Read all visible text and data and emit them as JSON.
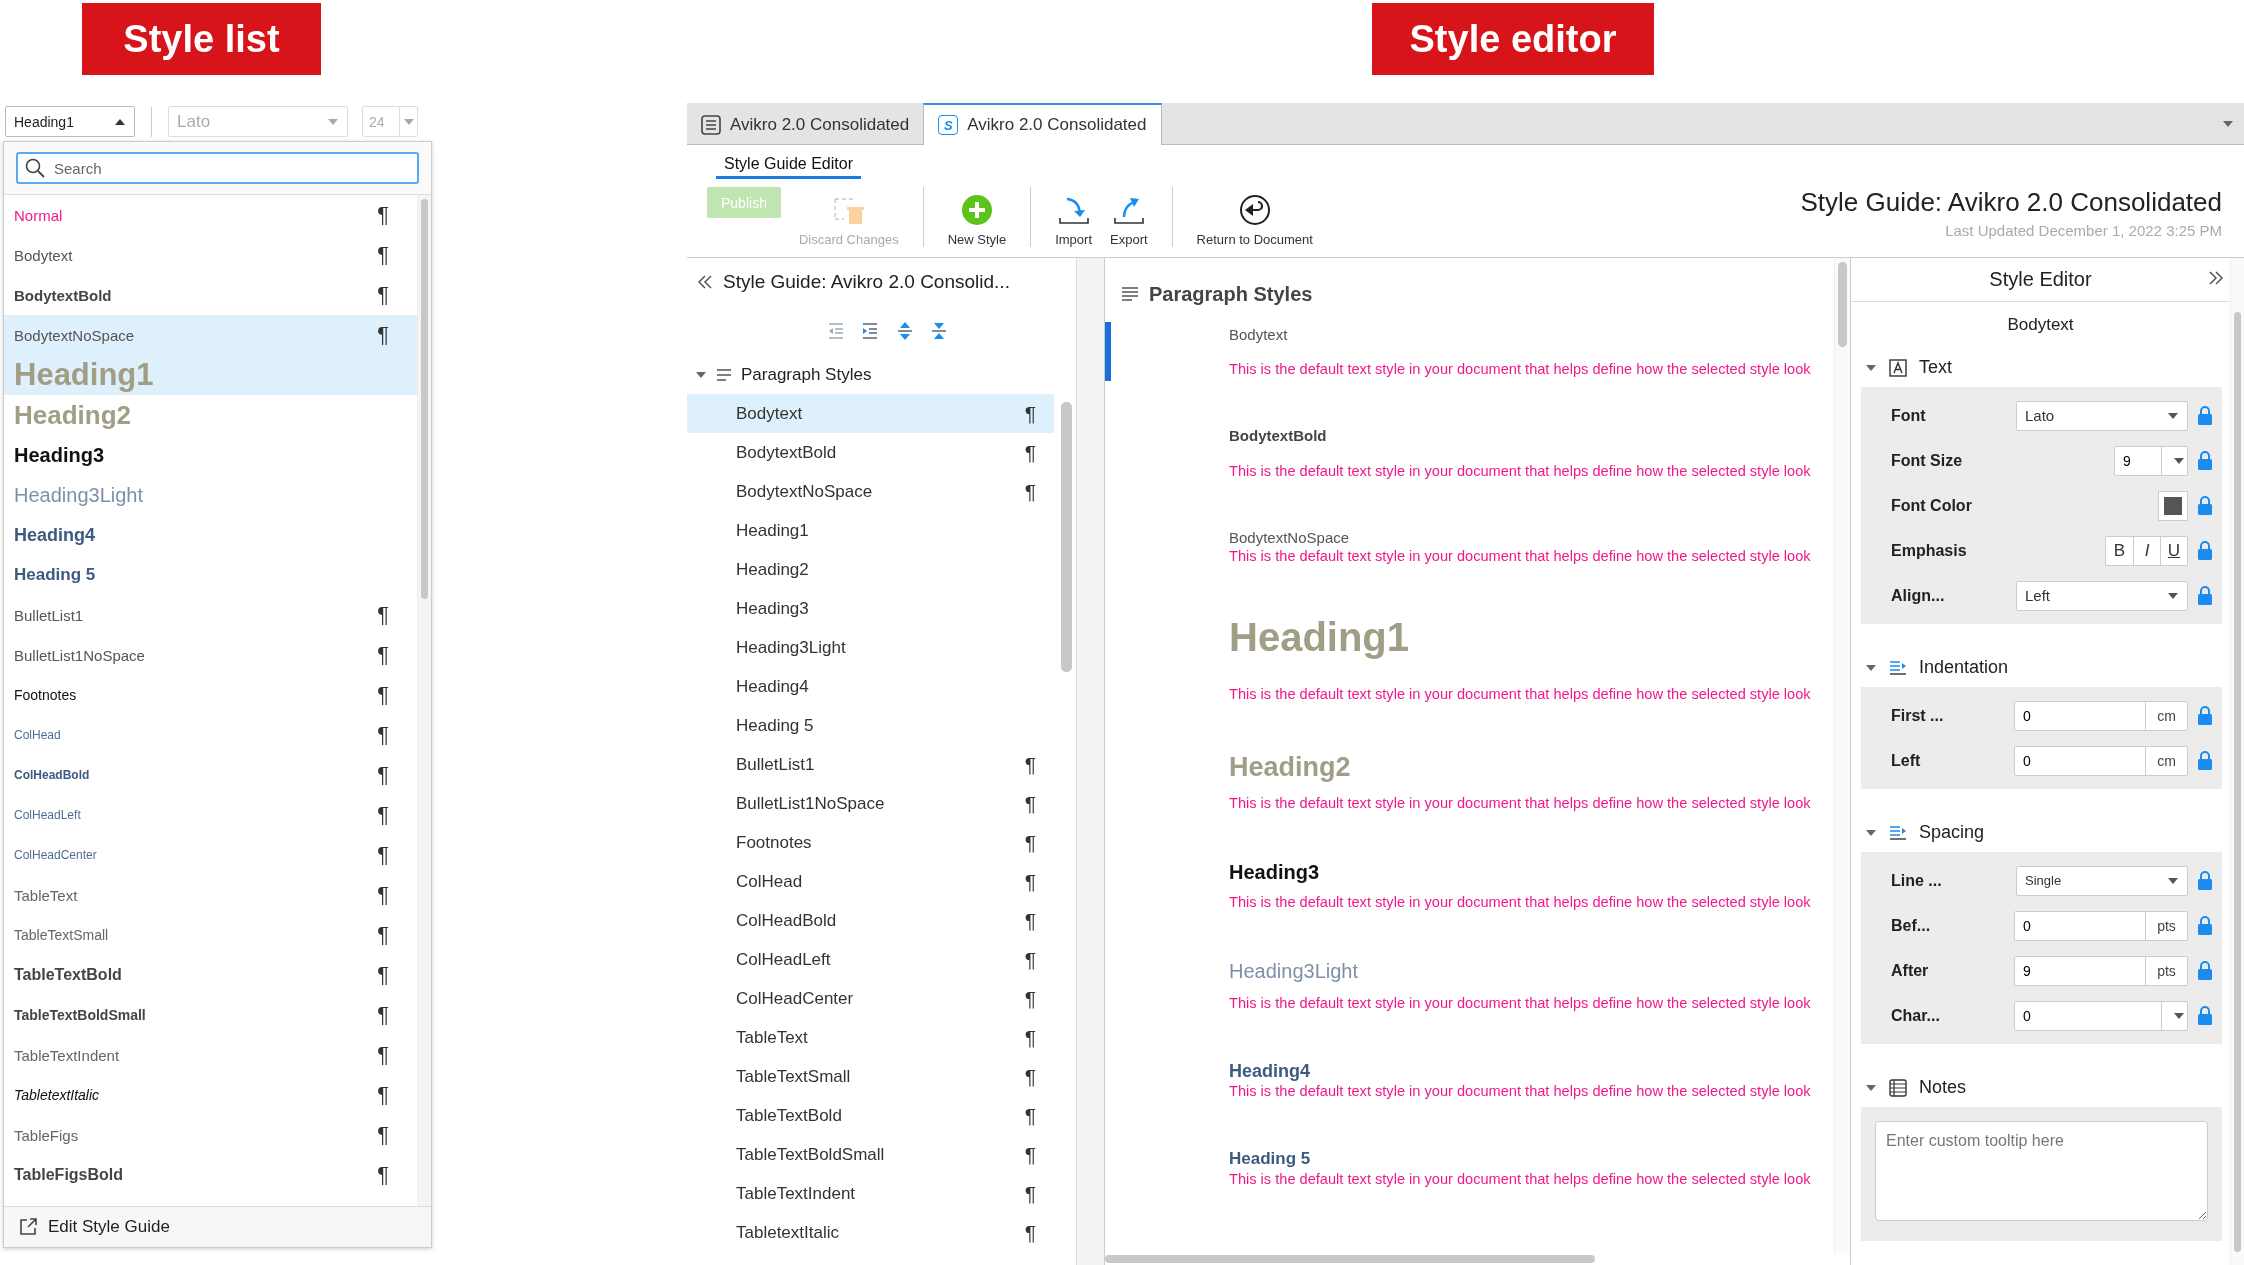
{
  "style_list": {
    "banner": "Style list",
    "style_select": {
      "value": "Heading1",
      "expanded": true
    },
    "font_select": {
      "value": "Lato",
      "disabled": true
    },
    "size_select": {
      "value": "24",
      "disabled": true
    },
    "search": {
      "placeholder": "Search"
    },
    "items": [
      {
        "label": "Normal",
        "kind": "normal",
        "mark": "¶",
        "selected": false
      },
      {
        "label": "Bodytext",
        "kind": "body",
        "mark": "¶",
        "selected": false
      },
      {
        "label": "BodytextBold",
        "kind": "body-bold",
        "mark": "¶",
        "selected": false
      },
      {
        "label": "BodytextNoSpace",
        "kind": "body",
        "mark": "¶",
        "selected": true
      },
      {
        "label": "Heading1",
        "kind": "h1",
        "selected": true
      },
      {
        "label": "Heading2",
        "kind": "h2",
        "selected": false
      },
      {
        "label": "Heading3",
        "kind": "h3",
        "selected": false
      },
      {
        "label": "Heading3Light",
        "kind": "h3light",
        "selected": false
      },
      {
        "label": "Heading4",
        "kind": "h4",
        "selected": false
      },
      {
        "label": "Heading 5",
        "kind": "h5",
        "selected": false
      },
      {
        "label": "BulletList1",
        "kind": "body",
        "mark": "¶",
        "selected": false
      },
      {
        "label": "BulletList1NoSpace",
        "kind": "body",
        "mark": "¶",
        "selected": false
      },
      {
        "label": "Footnotes",
        "kind": "footnote",
        "mark": "¶",
        "selected": false
      },
      {
        "label": "ColHead",
        "kind": "col",
        "mark": "¶",
        "selected": false
      },
      {
        "label": "ColHeadBold",
        "kind": "col-bold",
        "mark": "¶",
        "selected": false
      },
      {
        "label": "ColHeadLeft",
        "kind": "col",
        "mark": "¶",
        "selected": false
      },
      {
        "label": "ColHeadCenter",
        "kind": "col",
        "mark": "¶",
        "selected": false
      },
      {
        "label": "TableText",
        "kind": "table",
        "mark": "¶",
        "selected": false
      },
      {
        "label": "TableTextSmall",
        "kind": "table-small",
        "mark": "¶",
        "selected": false
      },
      {
        "label": "TableTextBold",
        "kind": "table-bold",
        "mark": "¶",
        "selected": false
      },
      {
        "label": "TableTextBoldSmall",
        "kind": "table-bold-small",
        "mark": "¶",
        "selected": false
      },
      {
        "label": "TableTextIndent",
        "kind": "table",
        "mark": "¶",
        "selected": false
      },
      {
        "label": "TabletextItalic",
        "kind": "italic",
        "mark": "¶",
        "selected": false
      },
      {
        "label": "TableFigs",
        "kind": "table",
        "mark": "¶",
        "selected": false
      },
      {
        "label": "TableFigsBold",
        "kind": "table-bold",
        "mark": "¶",
        "selected": false
      }
    ],
    "footer_link": "Edit Style Guide"
  },
  "style_editor": {
    "banner": "Style editor",
    "tabs": [
      {
        "label": "Avikro 2.0 Consolidated",
        "kind": "document",
        "selected": false
      },
      {
        "label": "Avikro 2.0 Consolidated",
        "kind": "style-guide",
        "icon_letter": "S",
        "selected": true
      }
    ],
    "ribbon_tab": "Style Guide Editor",
    "toolbar_groups": [
      {
        "buttons": [
          {
            "label": "Publish",
            "kind": "publish",
            "disabled": true
          },
          {
            "label": "Discard Changes",
            "kind": "discard",
            "disabled": true
          }
        ]
      },
      {
        "buttons": [
          {
            "label": "New Style",
            "kind": "new",
            "disabled": false
          }
        ]
      },
      {
        "buttons": [
          {
            "label": "Import",
            "kind": "import",
            "disabled": false
          },
          {
            "label": "Export",
            "kind": "export",
            "disabled": false
          }
        ]
      },
      {
        "buttons": [
          {
            "label": "Return to Document",
            "kind": "return",
            "disabled": false
          }
        ]
      }
    ],
    "title": "Style Guide: Avikro 2.0 Consolidated",
    "last_updated": "Last Updated December 1, 2022 3:25 PM",
    "tree": {
      "title": "Style Guide: Avikro 2.0 Consolid...",
      "groups": [
        {
          "label": "Paragraph Styles",
          "expanded": true,
          "children": [
            {
              "label": "Bodytext",
              "mark": "¶",
              "selected": true
            },
            {
              "label": "BodytextBold",
              "mark": "¶",
              "selected": false
            },
            {
              "label": "BodytextNoSpace",
              "mark": "¶",
              "selected": false
            },
            {
              "label": "Heading1",
              "selected": false
            },
            {
              "label": "Heading2",
              "selected": false
            },
            {
              "label": "Heading3",
              "selected": false
            },
            {
              "label": "Heading3Light",
              "selected": false
            },
            {
              "label": "Heading4",
              "selected": false
            },
            {
              "label": "Heading 5",
              "selected": false
            },
            {
              "label": "BulletList1",
              "mark": "¶",
              "selected": false
            },
            {
              "label": "BulletList1NoSpace",
              "mark": "¶",
              "selected": false
            },
            {
              "label": "Footnotes",
              "mark": "¶",
              "selected": false
            },
            {
              "label": "ColHead",
              "mark": "¶",
              "selected": false
            },
            {
              "label": "ColHeadBold",
              "mark": "¶",
              "selected": false
            },
            {
              "label": "ColHeadLeft",
              "mark": "¶",
              "selected": false
            },
            {
              "label": "ColHeadCenter",
              "mark": "¶",
              "selected": false
            },
            {
              "label": "TableText",
              "mark": "¶",
              "selected": false
            },
            {
              "label": "TableTextSmall",
              "mark": "¶",
              "selected": false
            },
            {
              "label": "TableTextBold",
              "mark": "¶",
              "selected": false
            },
            {
              "label": "TableTextBoldSmall",
              "mark": "¶",
              "selected": false
            },
            {
              "label": "TableTextIndent",
              "mark": "¶",
              "selected": false
            },
            {
              "label": "TabletextItalic",
              "mark": "¶",
              "selected": false
            }
          ]
        }
      ]
    },
    "preview": {
      "heading": "Paragraph Styles",
      "items": [
        {
          "name": "Bodytext",
          "kind": "body",
          "selected": true,
          "sample": "This is the default text style in your document that helps define how the selected style look"
        },
        {
          "name": "BodytextBold",
          "kind": "body-bold",
          "selected": false,
          "sample": "This is the default text style in your document that helps define how the selected style look"
        },
        {
          "name": "BodytextNoSpace",
          "kind": "body-nospace",
          "selected": false,
          "sample": "This is the default text style in your document that helps define how the selected style look"
        },
        {
          "name": "Heading1",
          "kind": "h1",
          "selected": false,
          "sample": "This is the default text style in your document that helps define how the selected style look"
        },
        {
          "name": "Heading2",
          "kind": "h2",
          "selected": false,
          "sample": "This is the default text style in your document that helps define how the selected style look"
        },
        {
          "name": "Heading3",
          "kind": "h3",
          "selected": false,
          "sample": "This is the default text style in your document that helps define how the selected style look"
        },
        {
          "name": "Heading3Light",
          "kind": "h3light",
          "selected": false,
          "sample": "This is the default text style in your document that helps define how the selected style look"
        },
        {
          "name": "Heading4",
          "kind": "h4",
          "selected": false,
          "sample": "This is the default text style in your document that helps define how the selected style look"
        },
        {
          "name": "Heading 5",
          "kind": "h5",
          "selected": false,
          "sample": "This is the default text style in your document that helps define how the selected style look"
        }
      ]
    },
    "inspector": {
      "title": "Style Editor",
      "style_name": "Bodytext",
      "sections": [
        {
          "label": "Text",
          "kind": "text",
          "expanded": true,
          "rows": [
            {
              "label": "Font",
              "kind": "select",
              "value": "Lato"
            },
            {
              "label": "Font Size",
              "kind": "number-select",
              "value": "9"
            },
            {
              "label": "Font Color",
              "kind": "color",
              "color": "#555555"
            },
            {
              "label": "Emphasis",
              "kind": "emphasis",
              "buttons": [
                "B",
                "I",
                "U"
              ]
            },
            {
              "label": "Align...",
              "kind": "select",
              "value": "Left"
            }
          ]
        },
        {
          "label": "Indentation",
          "kind": "indent",
          "expanded": true,
          "rows": [
            {
              "label": "First ...",
              "kind": "unit",
              "value": "0",
              "unit": "cm"
            },
            {
              "label": "Left",
              "kind": "unit",
              "value": "0",
              "unit": "cm"
            }
          ]
        },
        {
          "label": "Spacing",
          "kind": "spacing",
          "expanded": true,
          "rows": [
            {
              "label": "Line ...",
              "kind": "select",
              "value": "Single"
            },
            {
              "label": "Bef...",
              "kind": "unit",
              "value": "0",
              "unit": "pts"
            },
            {
              "label": "After",
              "kind": "unit",
              "value": "9",
              "unit": "pts"
            },
            {
              "label": "Char...",
              "kind": "combo",
              "value": "0"
            }
          ]
        },
        {
          "label": "Notes",
          "kind": "notes",
          "expanded": true,
          "placeholder": "Enter custom tooltip here"
        }
      ]
    }
  }
}
